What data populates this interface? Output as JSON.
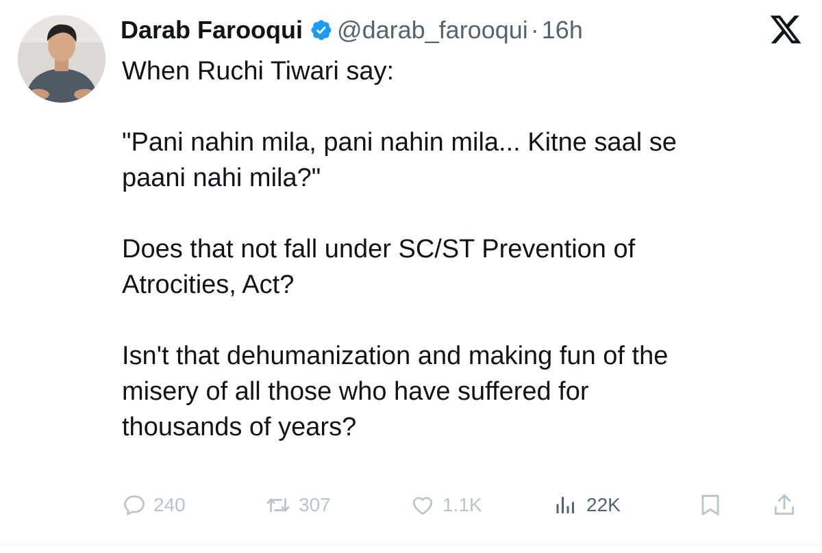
{
  "tweet": {
    "author_name": "Darab Farooqui",
    "handle": "@darab_farooqui",
    "separator": "·",
    "time": "16h",
    "verified": true,
    "body": {
      "p1": "When Ruchi Tiwari say:",
      "p2a": "\"Pani nahin mila, pani nahin mila... Kitne saal se",
      "p2b": "paani nahi mila?\"",
      "p3a": "Does that not fall under SC/ST Prevention of",
      "p3b": "Atrocities, Act?",
      "p4a": "Isn't that dehumanization and making fun of the",
      "p4b": "misery of all those who have suffered for",
      "p4c": "thousands of years?"
    }
  },
  "actions": {
    "replies": "240",
    "reposts": "307",
    "likes": "1.1K",
    "views": "22K"
  },
  "icons": {
    "brand": "x-logo-icon",
    "verified": "verified-badge-icon",
    "reply": "reply-icon",
    "repost": "repost-icon",
    "like": "heart-icon",
    "views": "views-icon",
    "bookmark": "bookmark-icon",
    "share": "share-icon"
  },
  "colors": {
    "text": "#0f1419",
    "secondary": "#536471",
    "faded_action": "#b9c3cb",
    "verified": "#1d9bf0"
  }
}
